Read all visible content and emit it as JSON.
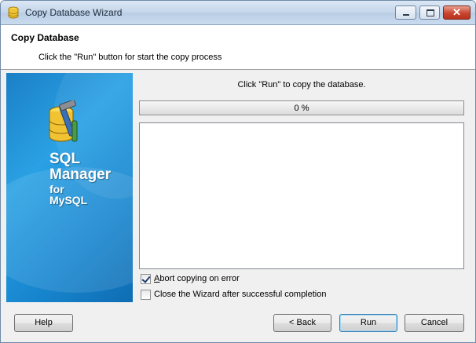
{
  "window": {
    "title": "Copy Database Wizard",
    "icon": "database-app-icon",
    "controls": [
      "minimize",
      "maximize",
      "close"
    ],
    "close_glyph": "✕"
  },
  "header": {
    "title": "Copy Database",
    "subtitle": "Click the \"Run\" button for start the copy process"
  },
  "side_panel": {
    "brand_line1": "SQL",
    "brand_line2": "Manager",
    "brand_line3": "for",
    "brand_line4": "MySQL",
    "colors": {
      "accent": "#1b7fc6",
      "light": "#2aa1e4"
    }
  },
  "main": {
    "info_text": "Click \"Run\" to copy the database.",
    "progress": {
      "percent": 0,
      "label": "0 %"
    },
    "log_lines": []
  },
  "options": {
    "abort_on_error": {
      "label": "Abort copying on error",
      "checked": true
    },
    "close_after": {
      "label": "Close the Wizard after successful completion",
      "checked": false
    }
  },
  "buttons": {
    "help": "Help",
    "back": "< Back",
    "run": "Run",
    "cancel": "Cancel"
  }
}
